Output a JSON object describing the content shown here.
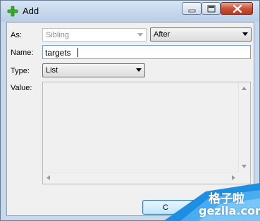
{
  "window": {
    "title": "Add",
    "icon": "green-plus-icon",
    "accent": "#3fae2a"
  },
  "form": {
    "as": {
      "label": "As:",
      "relation_value": "Sibling",
      "relation_disabled": true,
      "position_value": "After"
    },
    "name": {
      "label": "Name:",
      "value": "targets"
    },
    "type": {
      "label": "Type:",
      "value": "List"
    },
    "value": {
      "label": "Value:",
      "text": ""
    }
  },
  "buttons": {
    "ok_label": "C"
  },
  "watermark": {
    "cn": "格子啦",
    "en": "gezila.com"
  }
}
